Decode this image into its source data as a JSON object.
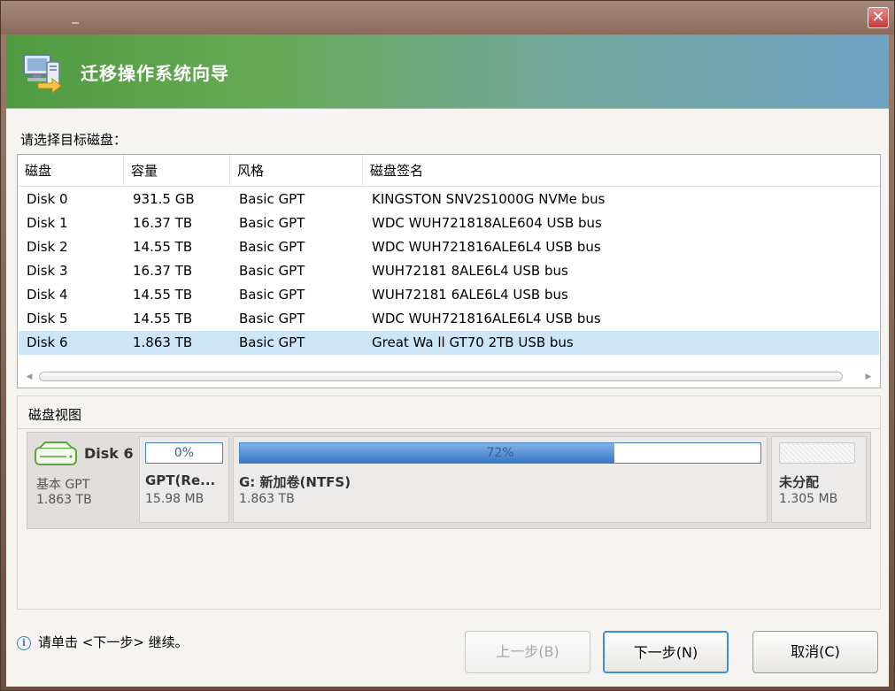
{
  "window": {
    "close_glyph": "✕"
  },
  "header": {
    "title": "迁移操作系统向导",
    "icon": "computer-migrate-icon"
  },
  "select_label": "请选择目标磁盘：",
  "table": {
    "columns": [
      "磁盘",
      "容量",
      "风格",
      "磁盘签名"
    ],
    "rows": [
      [
        "Disk 0",
        "931.5 GB",
        "Basic GPT",
        "KINGSTON SNV2S1000G NVMe bus"
      ],
      [
        "Disk 1",
        "16.37 TB",
        "Basic GPT",
        "WDC WUH721818ALE604 USB bus"
      ],
      [
        "Disk 2",
        "14.55 TB",
        "Basic GPT",
        "WDC WUH721816ALE6L4 USB bus"
      ],
      [
        "Disk 3",
        "16.37 TB",
        "Basic GPT",
        "WUH72181 8ALE6L4 USB bus"
      ],
      [
        "Disk 4",
        "14.55 TB",
        "Basic GPT",
        "WUH72181 6ALE6L4 USB bus"
      ],
      [
        "Disk 5",
        "14.55 TB",
        "Basic GPT",
        "WDC WUH721816ALE6L4 USB bus"
      ],
      [
        "Disk 6",
        "1.863 TB",
        "Basic GPT",
        "Great Wa ll GT70 2TB USB bus"
      ]
    ],
    "selected_row": 6
  },
  "disk_view": {
    "title": "磁盘视图",
    "disk": {
      "name": "Disk 6",
      "type": "基本 GPT",
      "size": "1.863 TB"
    },
    "partitions": [
      {
        "usage_label": "0%",
        "usage": 0.0,
        "name": "GPT(Re...",
        "size": "15.98 MB"
      },
      {
        "usage_label": "72%",
        "usage": 0.72,
        "name": "G: 新加卷(NTFS)",
        "size": "1.863 TB"
      },
      {
        "usage_label": "",
        "usage": 0.0,
        "name": "未分配",
        "size": "1.305 MB"
      }
    ]
  },
  "status": {
    "text": "请单击 <下一步> 继续。",
    "icon": "info-icon"
  },
  "buttons": {
    "prev": "上一步(B)",
    "next": "下一步(N)",
    "cancel": "取消(C)"
  },
  "colors": {
    "selected_row": "#cde6f7",
    "accent": "#3c8fd5",
    "header_green": "#4f9a3f",
    "header_blue": "#6ea2c4"
  }
}
